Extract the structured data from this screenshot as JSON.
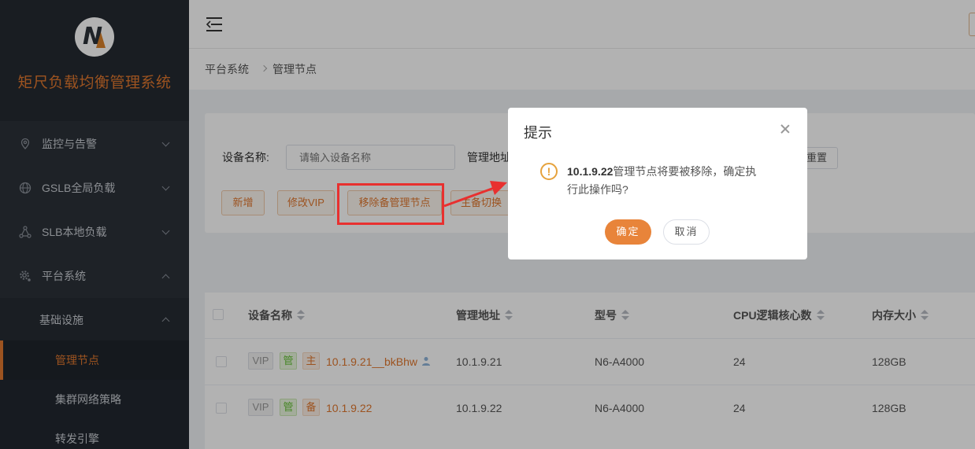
{
  "sidebar": {
    "app_title": "矩尺负载均衡管理系统",
    "menu": [
      {
        "label": "监控与告警",
        "icon": "location-pin-icon"
      },
      {
        "label": "GSLB全局负载",
        "icon": "globe-icon"
      },
      {
        "label": "SLB本地负载",
        "icon": "share-nodes-icon"
      },
      {
        "label": "平台系统",
        "icon": "gear-icon"
      }
    ],
    "submenu_group": "基础设施",
    "submenu": [
      {
        "label": "管理节点"
      },
      {
        "label": "集群网络策略"
      },
      {
        "label": "转发引擎"
      }
    ]
  },
  "breadcrumb": [
    "平台系统",
    "管理节点"
  ],
  "filter": {
    "device_name_label": "设备名称:",
    "device_name_placeholder": "请输入设备名称",
    "mgmt_addr_label": "管理地址",
    "reset_label": "重置"
  },
  "toolbar": {
    "add": "新增",
    "modify_vip": "修改VIP",
    "remove_backup": "移除备管理节点",
    "switch": "主备切换"
  },
  "table": {
    "columns": [
      "设备名称",
      "管理地址",
      "型号",
      "CPU逻辑核心数",
      "内存大小"
    ],
    "rows": [
      {
        "tags": [
          "VIP",
          "管",
          "主"
        ],
        "name": "10.1.9.21__bkBhw",
        "addr": "10.1.9.21",
        "model": "N6-A4000",
        "cpu": "24",
        "mem": "128GB"
      },
      {
        "tags": [
          "VIP",
          "管",
          "备"
        ],
        "name": "10.1.9.22",
        "addr": "10.1.9.22",
        "model": "N6-A4000",
        "cpu": "24",
        "mem": "128GB"
      }
    ]
  },
  "dialog": {
    "title": "提示",
    "message_bold": "10.1.9.22",
    "message_rest": "管理节点将要被移除，确定执行此操作吗?",
    "confirm": "确定",
    "cancel": "取消"
  },
  "colors": {
    "accent": "#e0772e",
    "sidebar_bg": "#2b3139",
    "annotation_red": "#e8302f"
  }
}
